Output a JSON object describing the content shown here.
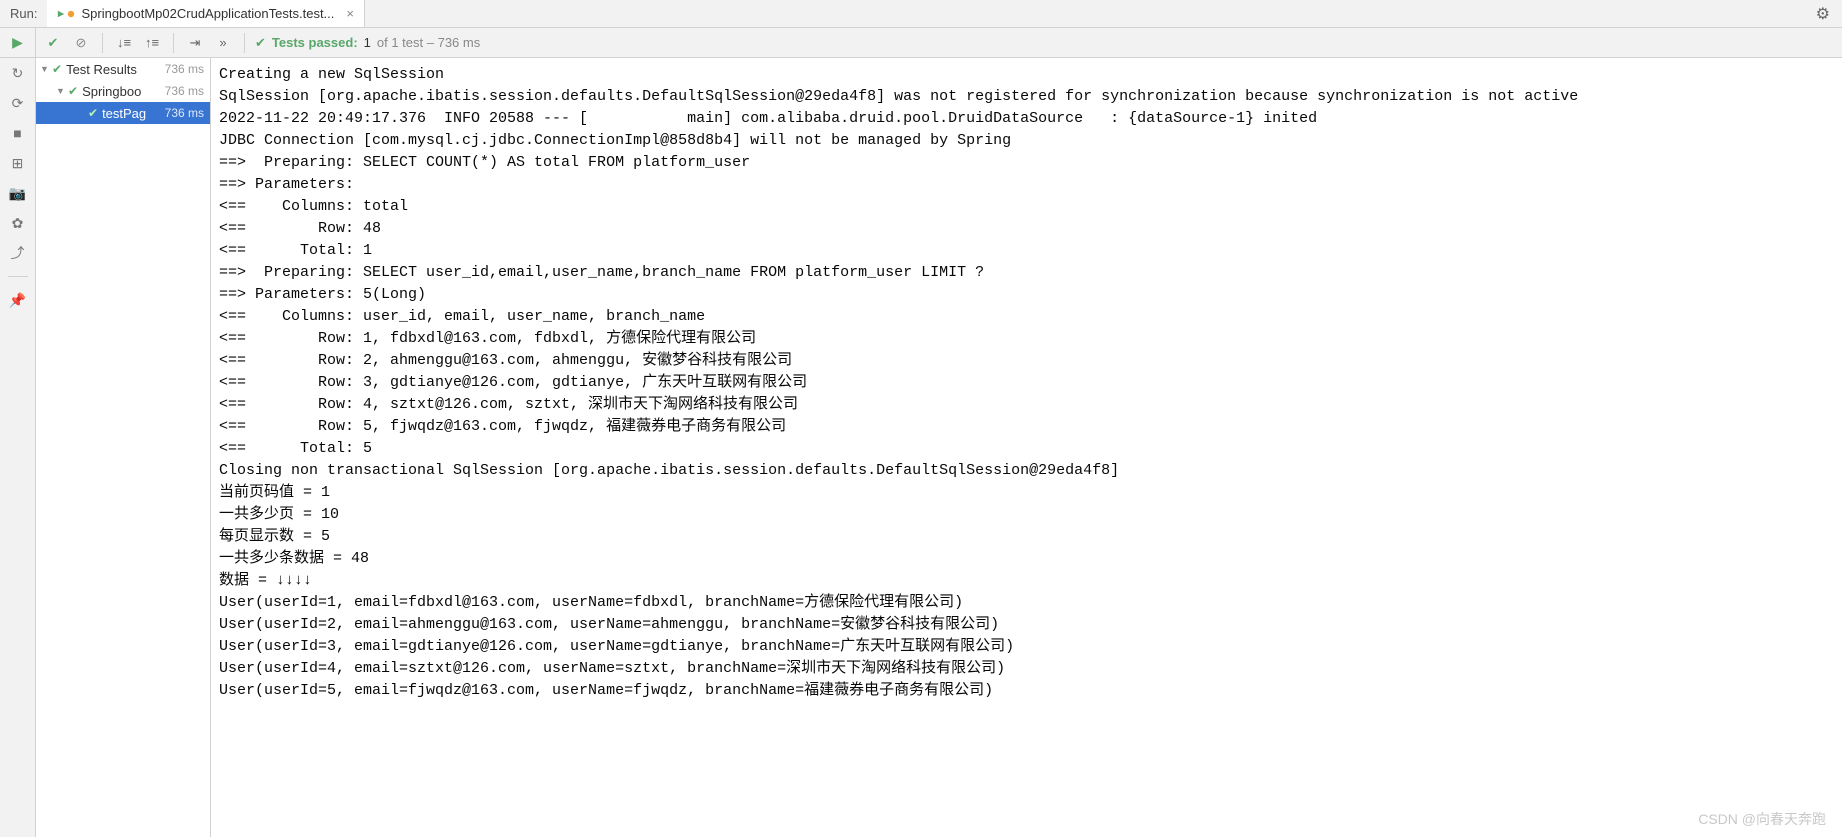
{
  "header": {
    "run_label": "Run:",
    "tab_title": "SpringbootMp02CrudApplicationTests.test...",
    "close_glyph": "×",
    "gear_glyph": "⚙"
  },
  "toolbar": {
    "play_glyph": "▶",
    "check_glyph": "✔",
    "stop_glyph": "⊘",
    "sort1_glyph": "↓≡",
    "sort2_glyph": "↑≡",
    "expand_glyph": "⇥",
    "more_glyph": "»",
    "status_check": "✔",
    "status_label": "Tests passed:",
    "status_passed": "1",
    "status_of": "of 1 test – 736 ms"
  },
  "side": {
    "rerun": "↻",
    "rerun_failed": "⟳",
    "stop": "■",
    "layout": "⊞",
    "camera": "📷",
    "bug": "✿",
    "exit": "⤴",
    "pin": "📌"
  },
  "tree": {
    "items": [
      {
        "arrow": "▼",
        "label": "Test Results",
        "time": "736 ms"
      },
      {
        "arrow": "▼",
        "label": "Springboo",
        "time": "736 ms"
      },
      {
        "arrow": "",
        "label": "testPag",
        "time": "736 ms"
      }
    ]
  },
  "console": {
    "lines": [
      "Creating a new SqlSession",
      "SqlSession [org.apache.ibatis.session.defaults.DefaultSqlSession@29eda4f8] was not registered for synchronization because synchronization is not active",
      "2022-11-22 20:49:17.376  INFO 20588 --- [           main] com.alibaba.druid.pool.DruidDataSource   : {dataSource-1} inited",
      "JDBC Connection [com.mysql.cj.jdbc.ConnectionImpl@858d8b4] will not be managed by Spring",
      "==>  Preparing: SELECT COUNT(*) AS total FROM platform_user",
      "==> Parameters: ",
      "<==    Columns: total",
      "<==        Row: 48",
      "<==      Total: 1",
      "==>  Preparing: SELECT user_id,email,user_name,branch_name FROM platform_user LIMIT ?",
      "==> Parameters: 5(Long)",
      "<==    Columns: user_id, email, user_name, branch_name",
      "<==        Row: 1, fdbxdl@163.com, fdbxdl, 方德保险代理有限公司",
      "<==        Row: 2, ahmenggu@163.com, ahmenggu, 安徽梦谷科技有限公司",
      "<==        Row: 3, gdtianye@126.com, gdtianye, 广东天叶互联网有限公司",
      "<==        Row: 4, sztxt@126.com, sztxt, 深圳市天下淘网络科技有限公司",
      "<==        Row: 5, fjwqdz@163.com, fjwqdz, 福建薇券电子商务有限公司",
      "<==      Total: 5",
      "Closing non transactional SqlSession [org.apache.ibatis.session.defaults.DefaultSqlSession@29eda4f8]",
      "当前页码值 = 1",
      "一共多少页 = 10",
      "每页显示数 = 5",
      "一共多少条数据 = 48",
      "数据 = ↓↓↓↓",
      "User(userId=1, email=fdbxdl@163.com, userName=fdbxdl, branchName=方德保险代理有限公司)",
      "User(userId=2, email=ahmenggu@163.com, userName=ahmenggu, branchName=安徽梦谷科技有限公司)",
      "User(userId=3, email=gdtianye@126.com, userName=gdtianye, branchName=广东天叶互联网有限公司)",
      "User(userId=4, email=sztxt@126.com, userName=sztxt, branchName=深圳市天下淘网络科技有限公司)",
      "User(userId=5, email=fjwqdz@163.com, userName=fjwqdz, branchName=福建薇券电子商务有限公司)"
    ]
  },
  "watermark": "CSDN @向春天奔跑"
}
